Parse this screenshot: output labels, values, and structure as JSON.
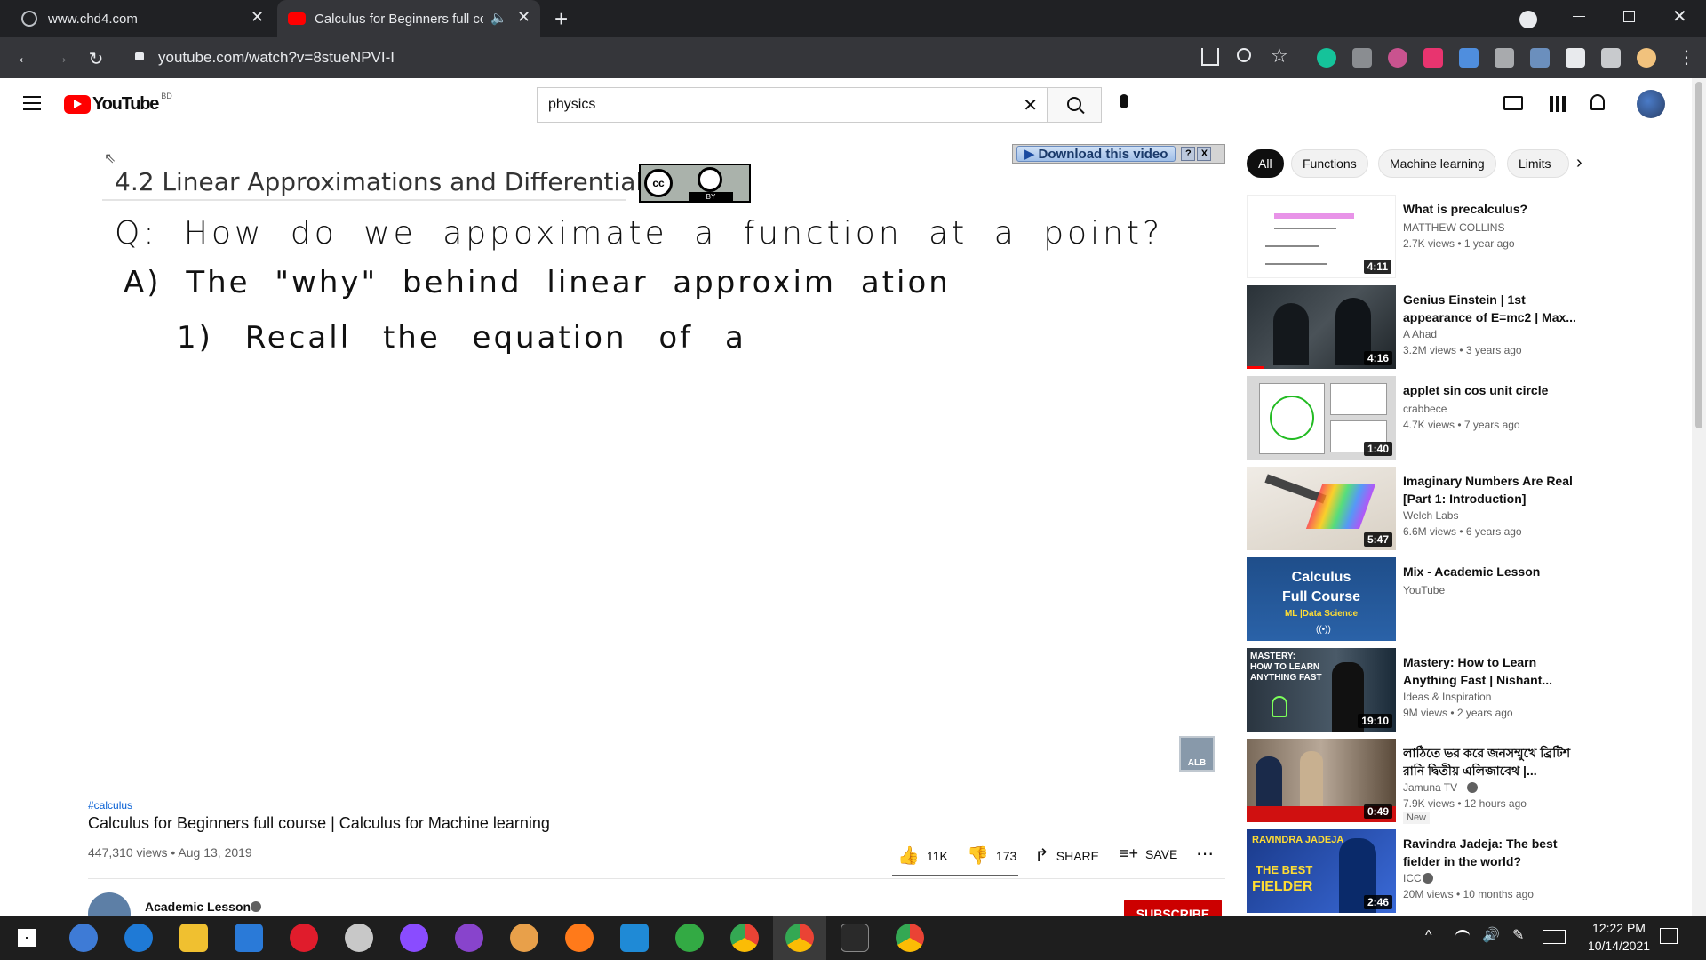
{
  "browser": {
    "tabs": [
      {
        "title": "www.chd4.com"
      },
      {
        "title": "Calculus for Beginners full co"
      }
    ],
    "url": "youtube.com/watch?v=8stueNPVI-I"
  },
  "yt": {
    "logo": "YouTube",
    "region": "BD",
    "search_query": "physics"
  },
  "video": {
    "slide_title": "4.2 Linear Approximations and Differentials",
    "cc_label": "BY",
    "download_label": "Download this video",
    "download_help": "?",
    "download_close": "X",
    "line1": "Q: How do we appoximate a function at a point?",
    "line2": "A) The \"why\" behind linear approxim ation",
    "line3": "1) Recall the equation of a",
    "watermark": "ALB"
  },
  "info": {
    "hashtag": "#calculus",
    "title": "Calculus for Beginners full course | Calculus for Machine learning",
    "views_date": "447,310 views • Aug 13, 2019",
    "likes": "11K",
    "dislikes": "173",
    "share": "SHARE",
    "save": "SAVE",
    "channel": "Academic Lesson",
    "subscribe": "SUBSCRIBE"
  },
  "chips": [
    "All",
    "Functions",
    "Machine learning",
    "Limits"
  ],
  "recommendations": [
    {
      "title": "What is precalculus?",
      "channel": "MATTHEW COLLINS",
      "meta": "2.7K views • 1 year ago",
      "duration": "4:11"
    },
    {
      "title": "Genius Einstein | 1st appearance of E=mc2 | Max...",
      "channel": "A Ahad",
      "meta": "3.2M views • 3 years ago",
      "duration": "4:16"
    },
    {
      "title": "applet sin cos unit circle",
      "channel": "crabbece",
      "meta": "4.7K views • 7 years ago",
      "duration": "1:40"
    },
    {
      "title": "Imaginary Numbers Are Real [Part 1: Introduction]",
      "channel": "Welch Labs",
      "meta": "6.6M views • 6 years ago",
      "duration": "5:47"
    },
    {
      "title": "Mix - Academic Lesson",
      "channel": "YouTube",
      "meta": "",
      "duration": "",
      "thumb_text1": "Calculus",
      "thumb_text2": "Full Course",
      "thumb_text3": "ML |Data Science"
    },
    {
      "title": "Mastery: How to Learn Anything Fast | Nishant...",
      "channel": "Ideas & Inspiration",
      "meta": "9M views • 2 years ago",
      "duration": "19:10",
      "thumb_text1": "MASTERY:",
      "thumb_text2": "HOW TO LEARN",
      "thumb_text3": "ANYTHING FAST"
    },
    {
      "title": "লাঠিতে ভর করে জনসম্মুখে ব্রিটিশ রানি দ্বিতীয় এলিজাবেথ |...",
      "channel": "Jamuna TV",
      "meta": "7.9K views • 12 hours ago",
      "duration": "0:49",
      "badge": "New"
    },
    {
      "title": "Ravindra Jadeja: The best fielder in the world?",
      "channel": "ICC",
      "meta": "20M views • 10 months ago",
      "duration": "2:46",
      "thumb_text1": "RAVINDRA JADEJA",
      "thumb_text2": "THE BEST",
      "thumb_text3": "FIELDER"
    }
  ],
  "taskbar": {
    "time": "12:22 PM",
    "date": "10/14/2021"
  }
}
